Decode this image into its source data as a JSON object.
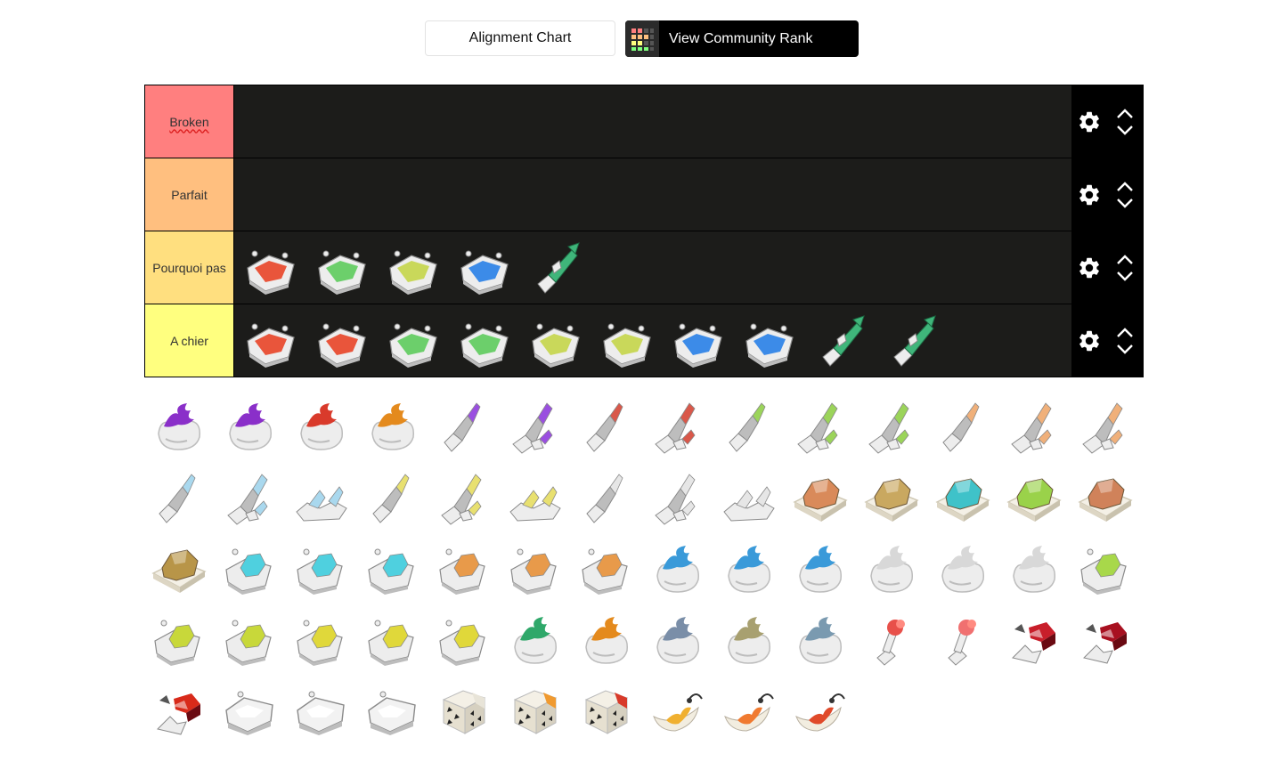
{
  "buttons": {
    "alignment_chart": "Alignment Chart",
    "community_rank": "View Community Rank"
  },
  "tiers": [
    {
      "label": "Broken",
      "color": "#ff7f7f",
      "spellcheck": true,
      "items": []
    },
    {
      "label": "Parfait",
      "color": "#ffbf7f",
      "spellcheck": false,
      "items": []
    },
    {
      "label": "Pourquoi pas",
      "color": "#ffdf7f",
      "spellcheck": false,
      "items": [
        {
          "icon": "red-gem-block-icon",
          "color": "#e9553b",
          "kind": "block"
        },
        {
          "icon": "green-gem-block-icon",
          "color": "#6ccf6b",
          "kind": "block"
        },
        {
          "icon": "yellowgreen-gem-block-icon",
          "color": "#c9d85a",
          "kind": "block"
        },
        {
          "icon": "blue-gem-block-icon",
          "color": "#3c8be8",
          "kind": "block"
        },
        {
          "icon": "green-crystal-spike-icon",
          "color": "#3fb57a",
          "kind": "spike"
        }
      ]
    },
    {
      "label": "A chier",
      "color": "#ffff7f",
      "spellcheck": false,
      "items": [
        {
          "icon": "red-gem-block-icon",
          "color": "#e9553b",
          "kind": "block"
        },
        {
          "icon": "red-gem-block-alt-icon",
          "color": "#e9553b",
          "kind": "block"
        },
        {
          "icon": "green-gem-block-icon",
          "color": "#6ccf6b",
          "kind": "block"
        },
        {
          "icon": "green-gem-block-alt-icon",
          "color": "#6ccf6b",
          "kind": "block"
        },
        {
          "icon": "yellowgreen-gem-block-icon",
          "color": "#c9d85a",
          "kind": "block"
        },
        {
          "icon": "yellowgreen-gem-block-alt-icon",
          "color": "#c9d85a",
          "kind": "block"
        },
        {
          "icon": "blue-gem-block-icon",
          "color": "#3c8be8",
          "kind": "block"
        },
        {
          "icon": "blue-gem-block-alt-icon",
          "color": "#3c8be8",
          "kind": "block"
        },
        {
          "icon": "green-crystal-spike-icon",
          "color": "#3fb57a",
          "kind": "spike"
        },
        {
          "icon": "green-crystal-spike-alt-icon",
          "color": "#3fb57a",
          "kind": "spike"
        }
      ]
    }
  ],
  "pool": [
    {
      "icon": "purple-flame-rock-icon",
      "color": "#8a2fc9",
      "kind": "flame"
    },
    {
      "icon": "purple-flame-rock-alt-icon",
      "color": "#8a2fc9",
      "kind": "flame"
    },
    {
      "icon": "red-flame-rock-icon",
      "color": "#d93a2b",
      "kind": "flame"
    },
    {
      "icon": "orange-flame-rock-icon",
      "color": "#e48a1d",
      "kind": "flame"
    },
    {
      "icon": "purple-crystal-shard-icon",
      "color": "#9a4fe0",
      "kind": "shard"
    },
    {
      "icon": "purple-crystal-cluster-icon",
      "color": "#9a4fe0",
      "kind": "cluster"
    },
    {
      "icon": "red-crystal-shard-icon",
      "color": "#d9584a",
      "kind": "shard"
    },
    {
      "icon": "red-crystal-cluster-icon",
      "color": "#d9584a",
      "kind": "cluster"
    },
    {
      "icon": "lime-crystal-shard-icon",
      "color": "#9bd45a",
      "kind": "shard"
    },
    {
      "icon": "lime-crystal-cluster-icon",
      "color": "#9bd45a",
      "kind": "cluster"
    },
    {
      "icon": "lime-crystal-cluster-alt-icon",
      "color": "#9bd45a",
      "kind": "cluster"
    },
    {
      "icon": "peach-crystal-shard-icon",
      "color": "#f0b07a",
      "kind": "shard"
    },
    {
      "icon": "peach-crystal-cluster-icon",
      "color": "#f0b07a",
      "kind": "cluster"
    },
    {
      "icon": "peach-crystal-cluster-alt-icon",
      "color": "#f0b07a",
      "kind": "cluster"
    },
    {
      "icon": "ice-crystal-shard-icon",
      "color": "#a9d8ee",
      "kind": "shard"
    },
    {
      "icon": "ice-crystal-cluster-icon",
      "color": "#a9d8ee",
      "kind": "cluster"
    },
    {
      "icon": "ice-crystal-pile-icon",
      "color": "#a9d8ee",
      "kind": "pile"
    },
    {
      "icon": "yellow-crystal-shard-icon",
      "color": "#e8e070",
      "kind": "shard"
    },
    {
      "icon": "yellow-crystal-cluster-icon",
      "color": "#e8e070",
      "kind": "cluster"
    },
    {
      "icon": "yellow-crystal-pile-icon",
      "color": "#e8e070",
      "kind": "pile"
    },
    {
      "icon": "white-crystal-shard-icon",
      "color": "#e6e6e6",
      "kind": "shard"
    },
    {
      "icon": "white-crystal-cluster-icon",
      "color": "#e6e6e6",
      "kind": "cluster"
    },
    {
      "icon": "white-crystal-pile-icon",
      "color": "#e6e6e6",
      "kind": "pile"
    },
    {
      "icon": "copper-ore-plate-icon",
      "color": "#d98a5a",
      "kind": "ore"
    },
    {
      "icon": "gold-ore-plate-icon",
      "color": "#c9a860",
      "kind": "ore"
    },
    {
      "icon": "teal-gem-plate-icon",
      "color": "#3fc2c9",
      "kind": "ore"
    },
    {
      "icon": "lime-gem-plate-icon",
      "color": "#9ad24a",
      "kind": "ore"
    },
    {
      "icon": "copper-gem-plate-icon",
      "color": "#d0825a",
      "kind": "ore"
    },
    {
      "icon": "gold-gem-plate-icon",
      "color": "#b89548",
      "kind": "ore"
    },
    {
      "icon": "cyan-gem-block-icon",
      "color": "#4fd0df",
      "kind": "gemblock"
    },
    {
      "icon": "cyan-gem-block-alt-icon",
      "color": "#4fd0df",
      "kind": "gemblock"
    },
    {
      "icon": "cyan-gem-block-tall-icon",
      "color": "#4fd0df",
      "kind": "gemblock"
    },
    {
      "icon": "orange-gem-block-icon",
      "color": "#e89a4a",
      "kind": "gemblock"
    },
    {
      "icon": "orange-gem-block-alt-icon",
      "color": "#e89a4a",
      "kind": "gemblock"
    },
    {
      "icon": "orange-gem-block-tall-icon",
      "color": "#e89a4a",
      "kind": "gemblock"
    },
    {
      "icon": "blue-flame-rock-icon",
      "color": "#3a9ad9",
      "kind": "flame"
    },
    {
      "icon": "blue-flame-rock-alt-icon",
      "color": "#3a9ad9",
      "kind": "flame"
    },
    {
      "icon": "blue-flame-rock-tall-icon",
      "color": "#3a9ad9",
      "kind": "flame"
    },
    {
      "icon": "white-flame-rock-icon",
      "color": "#d8d8d8",
      "kind": "flame"
    },
    {
      "icon": "white-flame-rock-alt-icon",
      "color": "#d8d8d8",
      "kind": "flame"
    },
    {
      "icon": "white-flame-rock-tall-icon",
      "color": "#d8d8d8",
      "kind": "flame"
    },
    {
      "icon": "lime-gem-block-icon",
      "color": "#a8d84a",
      "kind": "gemblock"
    },
    {
      "icon": "chartreuse-gem-block-icon",
      "color": "#c8d83a",
      "kind": "gemblock"
    },
    {
      "icon": "chartreuse-gem-block-alt-icon",
      "color": "#c8d83a",
      "kind": "gemblock"
    },
    {
      "icon": "yellow-gem-block-icon",
      "color": "#e0d83a",
      "kind": "gemblock"
    },
    {
      "icon": "yellow-gem-block-alt-icon",
      "color": "#e0d83a",
      "kind": "gemblock"
    },
    {
      "icon": "yellow-gem-block-tall-icon",
      "color": "#e0d83a",
      "kind": "gemblock"
    },
    {
      "icon": "green-flame-rock-icon",
      "color": "#2fa86a",
      "kind": "flame"
    },
    {
      "icon": "orange-flame-rock-alt-icon",
      "color": "#e48a1d",
      "kind": "flame"
    },
    {
      "icon": "steel-flame-rock-icon",
      "color": "#7a8ea8",
      "kind": "flame"
    },
    {
      "icon": "olive-flame-rock-icon",
      "color": "#a8a070",
      "kind": "flame"
    },
    {
      "icon": "slate-flame-rock-icon",
      "color": "#7a9ab0",
      "kind": "flame"
    },
    {
      "icon": "coral-spike-icon",
      "color": "#e8504a",
      "kind": "coral"
    },
    {
      "icon": "coral-spike-pair-icon",
      "color": "#f07070",
      "kind": "coral"
    },
    {
      "icon": "red-cube-spike-icon",
      "color": "#c81e2a",
      "kind": "redcube"
    },
    {
      "icon": "red-cube-spike-alt-icon",
      "color": "#a81020",
      "kind": "redcube"
    },
    {
      "icon": "red-cube-cluster-icon",
      "color": "#d82a1a",
      "kind": "redcube"
    },
    {
      "icon": "white-stone-block-icon",
      "color": "#f2f2f2",
      "kind": "stone"
    },
    {
      "icon": "white-stone-block-alt-icon",
      "color": "#f2f2f2",
      "kind": "stone"
    },
    {
      "icon": "white-stone-block-tall-icon",
      "color": "#f2f2f2",
      "kind": "stone"
    },
    {
      "icon": "dotted-dice-icon",
      "color": "#e8e4d8",
      "kind": "dice"
    },
    {
      "icon": "orange-dotted-dice-icon",
      "color": "#f09a30",
      "kind": "dice"
    },
    {
      "icon": "red-dotted-dice-icon",
      "color": "#d83a2a",
      "kind": "dice"
    },
    {
      "icon": "yellow-flame-horn-icon",
      "color": "#f0b030",
      "kind": "horn"
    },
    {
      "icon": "orange-flame-horn-icon",
      "color": "#f07a30",
      "kind": "horn"
    },
    {
      "icon": "red-flame-horn-icon",
      "color": "#e04a2a",
      "kind": "horn"
    }
  ]
}
